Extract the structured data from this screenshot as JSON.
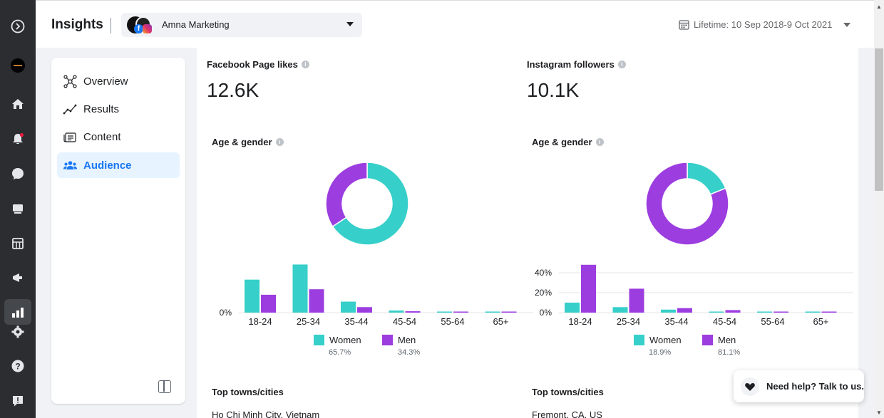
{
  "header": {
    "title": "Insights",
    "account_name": "Amna Marketing",
    "date_range": "Lifetime: 10 Sep 2018-9 Oct 2021"
  },
  "sidebar": {
    "items": [
      {
        "label": "Overview",
        "icon": "network-icon",
        "active": false
      },
      {
        "label": "Results",
        "icon": "line-chart-icon",
        "active": false
      },
      {
        "label": "Content",
        "icon": "content-icon",
        "active": false
      },
      {
        "label": "Audience",
        "icon": "people-icon",
        "active": true
      }
    ]
  },
  "rail": {
    "icons": [
      "logo-icon",
      "avatar",
      "home-icon",
      "notifications-icon",
      "messages-icon",
      "pages-icon",
      "planner-icon",
      "ads-icon",
      "insights-icon",
      "settings-icon",
      "help-icon",
      "report-icon"
    ],
    "notification_color": "#e41e3f"
  },
  "facebook": {
    "metric_label": "Facebook Page likes",
    "metric_value": "12.6K",
    "section_label": "Age & gender",
    "top_cities_label": "Top towns/cities",
    "first_city": "Ho Chi Minh City, Vietnam",
    "legend": [
      {
        "label": "Women",
        "value": "65.7%",
        "color": "#36cfc9"
      },
      {
        "label": "Men",
        "value": "34.3%",
        "color": "#9c3de0"
      }
    ]
  },
  "instagram": {
    "metric_label": "Instagram followers",
    "metric_value": "10.1K",
    "section_label": "Age & gender",
    "top_cities_label": "Top towns/cities",
    "first_city": "Fremont, CA, US",
    "legend": [
      {
        "label": "Women",
        "value": "18.9%",
        "color": "#36cfc9"
      },
      {
        "label": "Men",
        "value": "81.1%",
        "color": "#9c3de0"
      }
    ]
  },
  "help": {
    "label": "Need help? Talk to us."
  },
  "chart_data": [
    {
      "type": "pie",
      "categories": [
        "Women",
        "Men"
      ],
      "values": [
        65.7,
        34.3
      ],
      "colors": [
        "#36cfc9",
        "#9c3de0"
      ],
      "donut": true
    },
    {
      "type": "bar",
      "categories": [
        "18-24",
        "25-34",
        "35-44",
        "45-54",
        "55-64",
        "65+"
      ],
      "series": [
        {
          "name": "Women",
          "values": [
            24,
            35,
            8,
            1.5,
            0.3,
            0.2
          ],
          "color": "#36cfc9"
        },
        {
          "name": "Men",
          "values": [
            13,
            17,
            4,
            1,
            0.2,
            0.1
          ],
          "color": "#9c3de0"
        }
      ],
      "ytick_labels": [
        "0%"
      ],
      "ylim": [
        0,
        40
      ],
      "grid": false
    },
    {
      "type": "pie",
      "categories": [
        "Women",
        "Men"
      ],
      "values": [
        18.9,
        81.1
      ],
      "colors": [
        "#36cfc9",
        "#9c3de0"
      ],
      "donut": true
    },
    {
      "type": "bar",
      "categories": [
        "18-24",
        "25-34",
        "35-44",
        "45-54",
        "55-64",
        "65+"
      ],
      "series": [
        {
          "name": "Women",
          "values": [
            10,
            5.5,
            3,
            1,
            0.3,
            0.2
          ],
          "color": "#36cfc9"
        },
        {
          "name": "Men",
          "values": [
            48,
            24,
            4.5,
            2.5,
            0.8,
            1
          ],
          "color": "#9c3de0"
        }
      ],
      "ytick_labels": [
        "0%",
        "20%",
        "40%"
      ],
      "yticks": [
        0,
        20,
        40
      ],
      "ylim": [
        0,
        50
      ],
      "grid": true
    }
  ]
}
